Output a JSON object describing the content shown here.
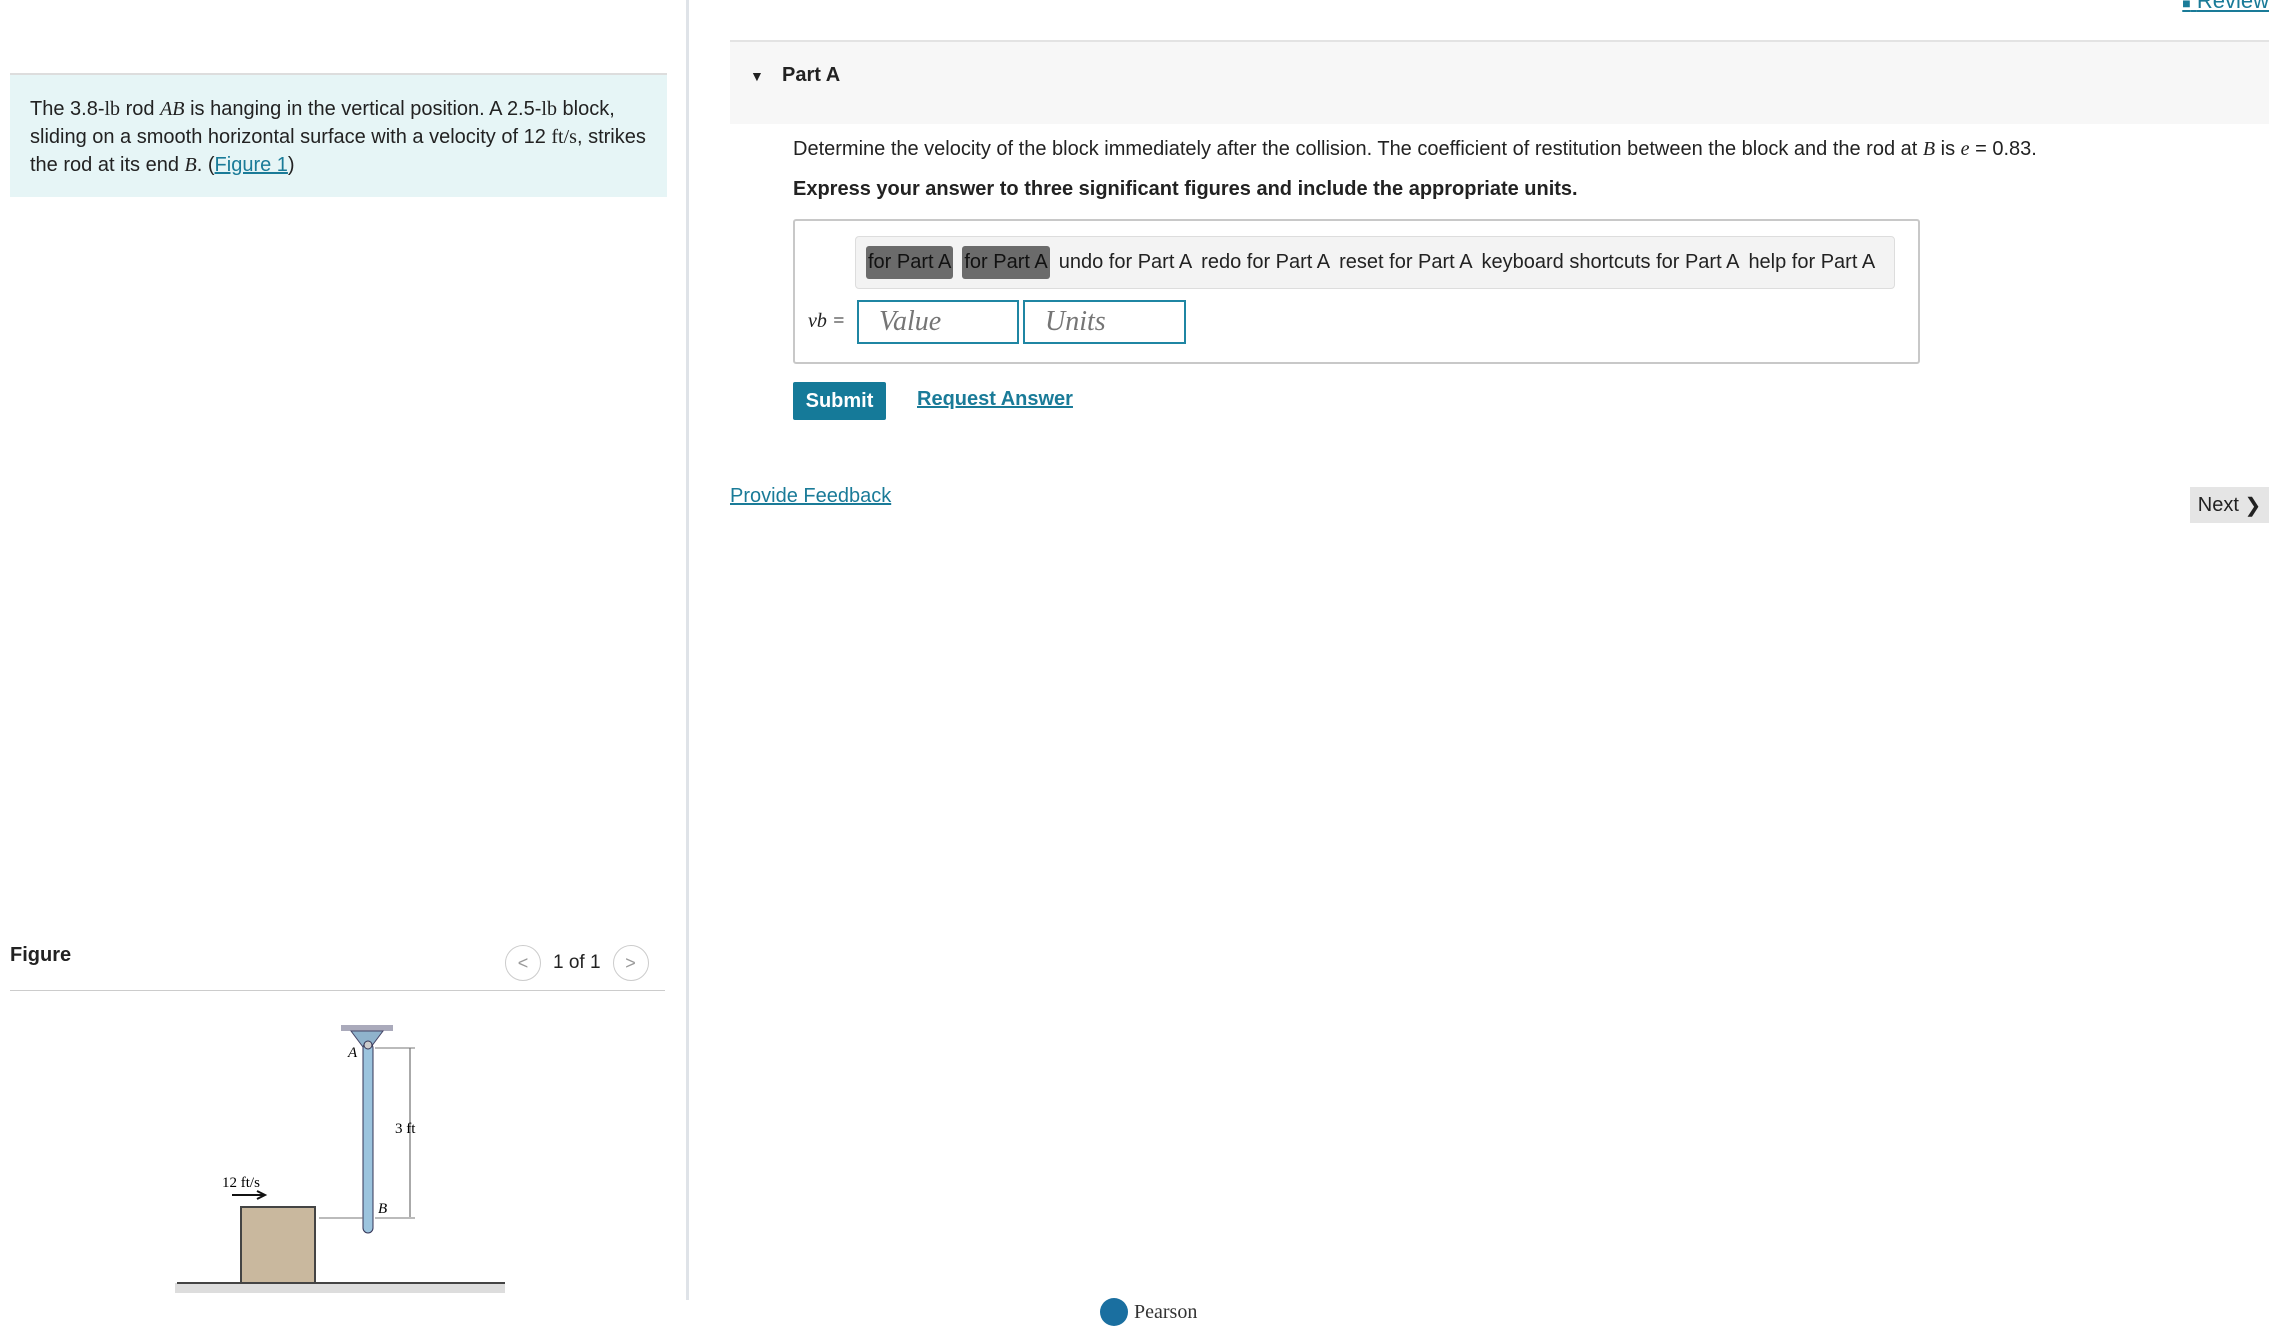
{
  "problem": {
    "t1": "The 3.8-",
    "lb": "lb",
    "t2": " rod ",
    "ab": "AB",
    "t3": " is hanging in the vertical position. A 2.5-",
    "lb2": "lb",
    "t4": " block, sliding on a smooth horizontal surface with a velocity of 12 ",
    "fts": "ft/s",
    "t5": ", strikes the rod at its end ",
    "b": "B",
    "t6": ". (",
    "link": "Figure 1",
    "t7": ")"
  },
  "figure": {
    "title": "Figure",
    "pager": "1 of 1",
    "labels": {
      "speed": "12 ft/s",
      "length": "3 ft",
      "a": "A",
      "b": "B"
    }
  },
  "header": {
    "review": "Review",
    "part": "Part A"
  },
  "question": {
    "text1": "Determine the velocity of the block immediately after the collision. The coefficient of restitution between the block and the rod at ",
    "b": "B",
    "text2": " is ",
    "e": "e",
    "text3": " = 0.83.",
    "instruction": "Express your answer to three significant figures and include the appropriate units."
  },
  "toolbar": {
    "items": [
      "for Part A",
      "for Part A",
      "undo for Part A",
      "redo for Part A",
      "reset for Part A",
      "keyboard shortcuts for Part A",
      "help for Part A"
    ]
  },
  "answer": {
    "label": "vb =",
    "value_placeholder": "Value",
    "units_placeholder": "Units"
  },
  "actions": {
    "submit": "Submit",
    "request": "Request Answer",
    "feedback": "Provide Feedback",
    "next": "Next"
  },
  "footer": {
    "brand": "Pearson"
  },
  "colors": {
    "accent": "#157a99",
    "problem_bg": "#e6f5f6"
  }
}
